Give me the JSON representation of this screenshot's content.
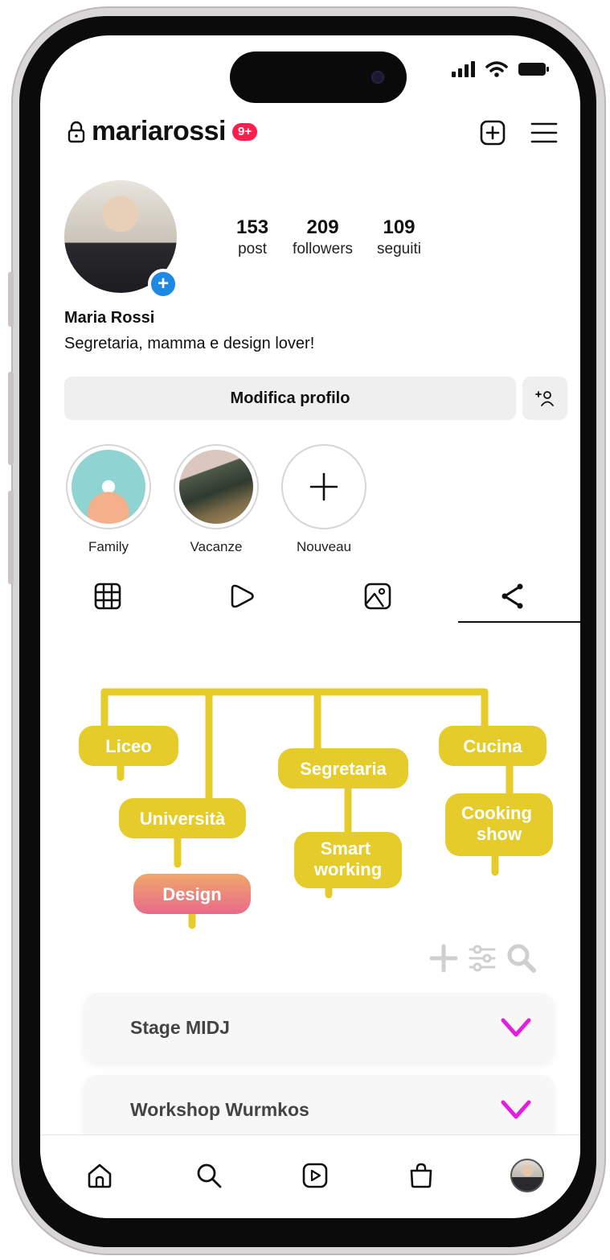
{
  "header": {
    "username": "mariarossi",
    "notification_badge": "9+"
  },
  "profile": {
    "stats": [
      {
        "value": "153",
        "label": "post"
      },
      {
        "value": "209",
        "label": "followers"
      },
      {
        "value": "109",
        "label": "seguiti"
      }
    ],
    "name": "Maria Rossi",
    "bio": "Segretaria, mamma e design lover!",
    "edit_button": "Modifica profilo"
  },
  "highlights": [
    {
      "label": "Family"
    },
    {
      "label": "Vacanze"
    },
    {
      "label": "Nouveau"
    }
  ],
  "tabs": [
    {
      "icon": "grid-icon"
    },
    {
      "icon": "reels-icon"
    },
    {
      "icon": "tagged-photo-icon"
    },
    {
      "icon": "share-tree-icon",
      "active": true
    }
  ],
  "tree": {
    "nodes": [
      {
        "label": "Liceo"
      },
      {
        "label": "Università"
      },
      {
        "label": "Design"
      },
      {
        "label": "Segretaria"
      },
      {
        "label": "Smart working"
      },
      {
        "label": "Cucina"
      },
      {
        "label": "Cooking show"
      }
    ],
    "node_color": "#e6cc2a",
    "highlight_gradient": [
      "#f0a66a",
      "#e86a8c"
    ]
  },
  "tools": [
    "add-icon",
    "filter-icon",
    "search-icon"
  ],
  "accordion": [
    {
      "label": "Stage MIDJ"
    },
    {
      "label": "Workshop Wurmkos"
    }
  ],
  "accent_color": "#e21fe0",
  "bottom_nav": [
    "home-icon",
    "search-icon",
    "reels-icon",
    "shop-icon",
    "profile-avatar"
  ]
}
